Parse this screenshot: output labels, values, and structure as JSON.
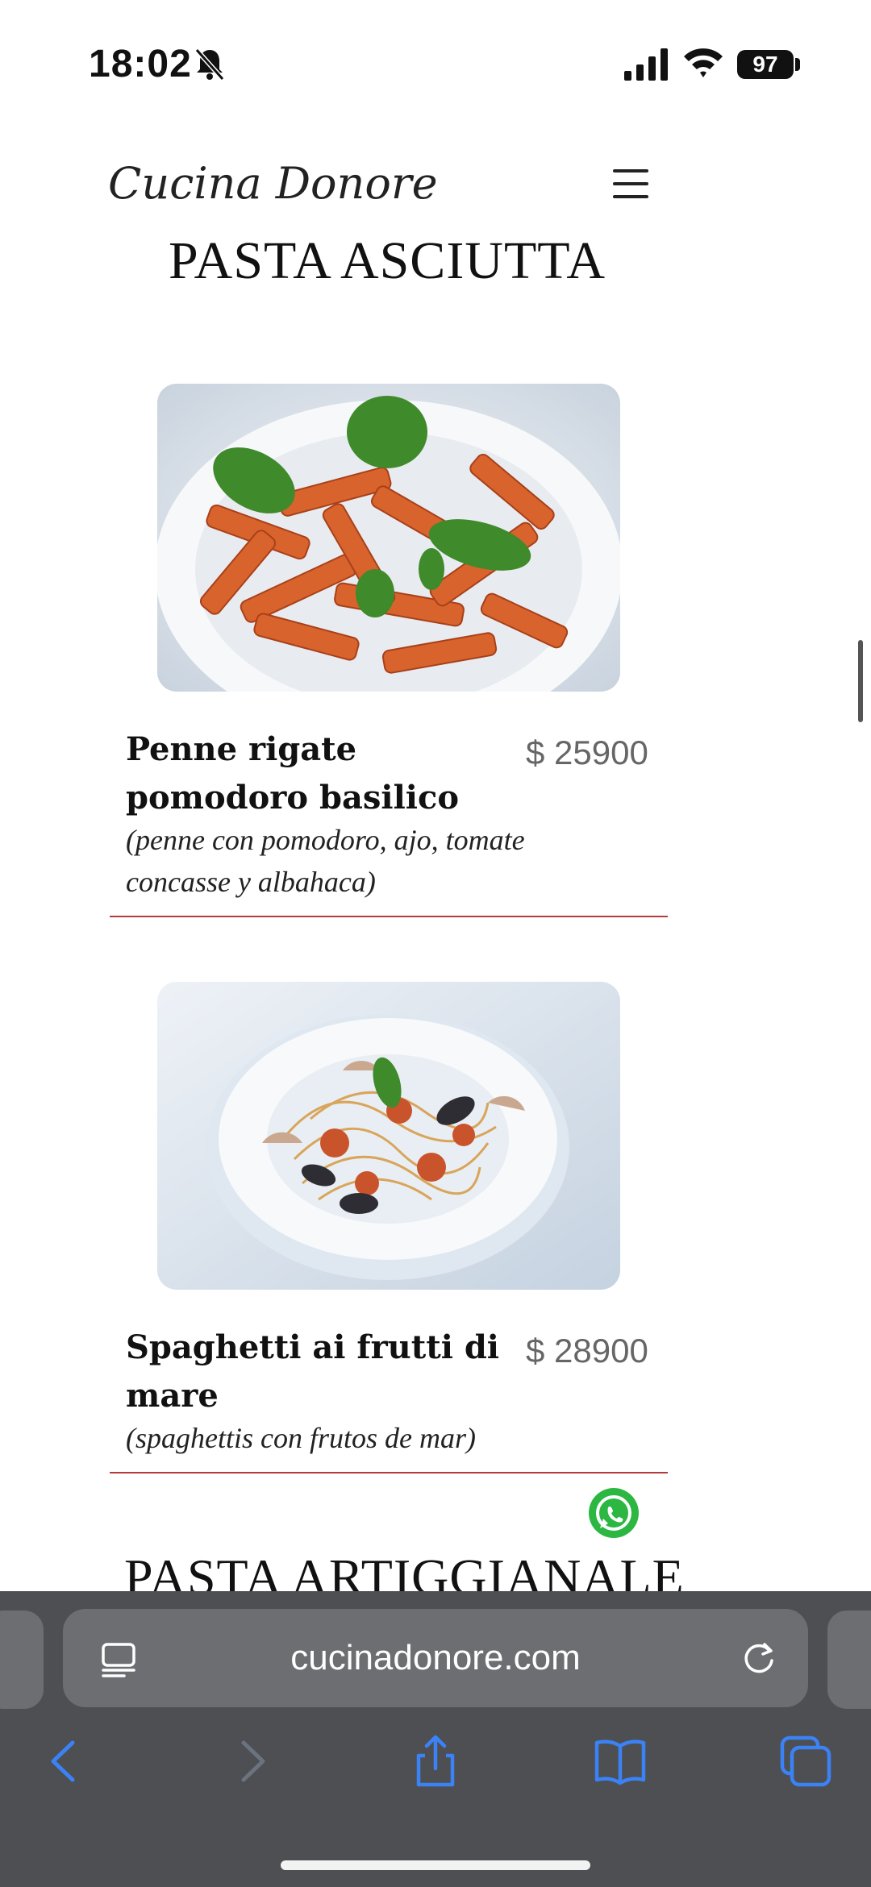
{
  "status_bar": {
    "time": "18:02",
    "battery": "97"
  },
  "site": {
    "brand": "Cucina Donore"
  },
  "sections": [
    {
      "title": "PASTA ASCIUTTA"
    },
    {
      "title": "PASTA ARTIGGIANALE"
    }
  ],
  "dishes": [
    {
      "name": "Penne rigate pomodoro basilico",
      "price": "$ 25900",
      "description": "(penne con pomodoro, ajo, tomate concasse y albahaca)"
    },
    {
      "name": "Spaghetti ai frutti di mare",
      "price": "$ 28900",
      "description": "(spaghettis con frutos de mar)"
    }
  ],
  "browser": {
    "url": "cucinadonore.com"
  },
  "colors": {
    "accent_divider": "#b53a3a",
    "whatsapp": "#2bb741",
    "toolbar_icon": "#3b82f6"
  }
}
